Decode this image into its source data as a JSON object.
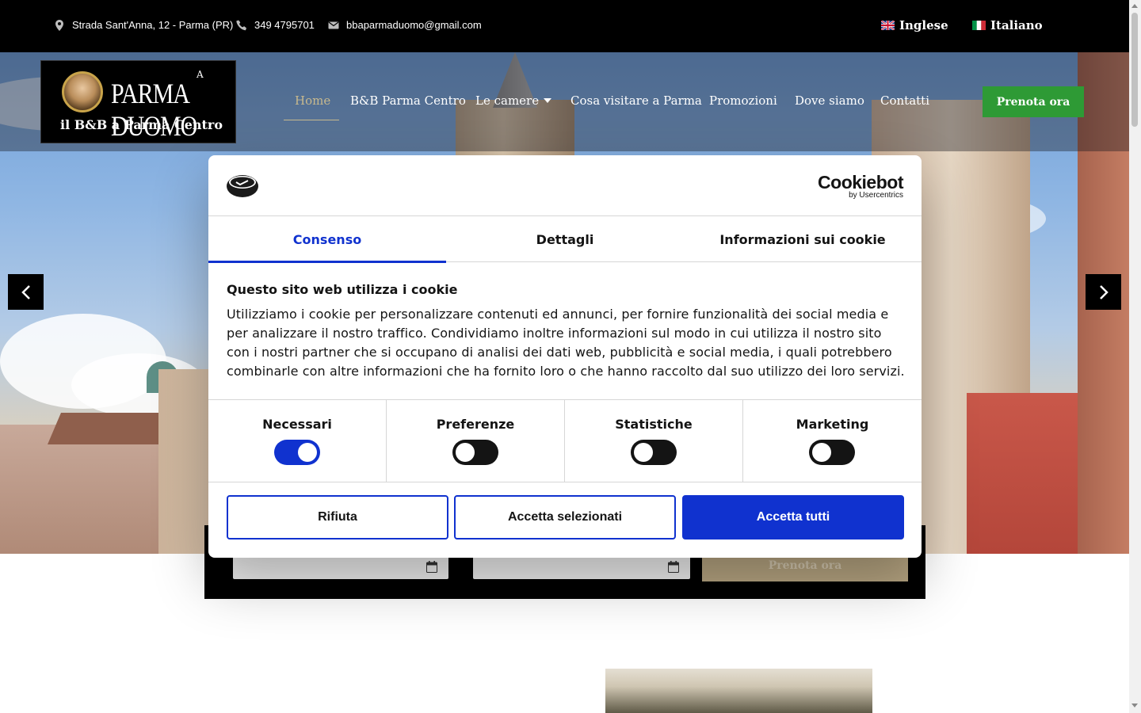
{
  "topbar": {
    "address": "Strada Sant'Anna, 12 - Parma (PR)",
    "phone": "349 4795701",
    "email": "bbaparmaduomo@gmail.com",
    "languages": [
      {
        "label": "Inglese",
        "flag": "uk-flag-icon"
      },
      {
        "label": "Italiano",
        "flag": "italy-flag-icon"
      }
    ]
  },
  "logo": {
    "prefix": "A",
    "brand": "PARMA DUOMO",
    "tagline": "il B&B a Parma Centro"
  },
  "nav": {
    "items": [
      "Home",
      "B&B Parma Centro",
      "Le camere",
      "Cosa visitare a Parma",
      "Promozioni",
      "Dove siamo",
      "Contatti"
    ],
    "active": "Home",
    "book_label": "Prenota ora"
  },
  "booking": {
    "button_label": "Prenota ora"
  },
  "cookie": {
    "provider": "Cookiebot",
    "provider_by": "by Usercentrics",
    "tabs": [
      "Consenso",
      "Dettagli",
      "Informazioni sui cookie"
    ],
    "active_tab": "Consenso",
    "title": "Questo sito web utilizza i cookie",
    "text": "Utilizziamo i cookie per personalizzare contenuti ed annunci, per fornire funzionalità dei social media e per analizzare il nostro traffico. Condividiamo inoltre informazioni sul modo in cui utilizza il nostro sito con i nostri partner che si occupano di analisi dei dati web, pubblicità e social media, i quali potrebbero combinarle con altre informazioni che ha fornito loro o che hanno raccolto dal suo utilizzo dei loro servizi.",
    "toggles": [
      {
        "label": "Necessari",
        "on": true
      },
      {
        "label": "Preferenze",
        "on": false
      },
      {
        "label": "Statistiche",
        "on": false
      },
      {
        "label": "Marketing",
        "on": false
      }
    ],
    "buttons": {
      "reject": "Rifiuta",
      "accept_selected": "Accetta selezionati",
      "accept_all": "Accetta tutti"
    },
    "accent_color": "#1032cf"
  }
}
